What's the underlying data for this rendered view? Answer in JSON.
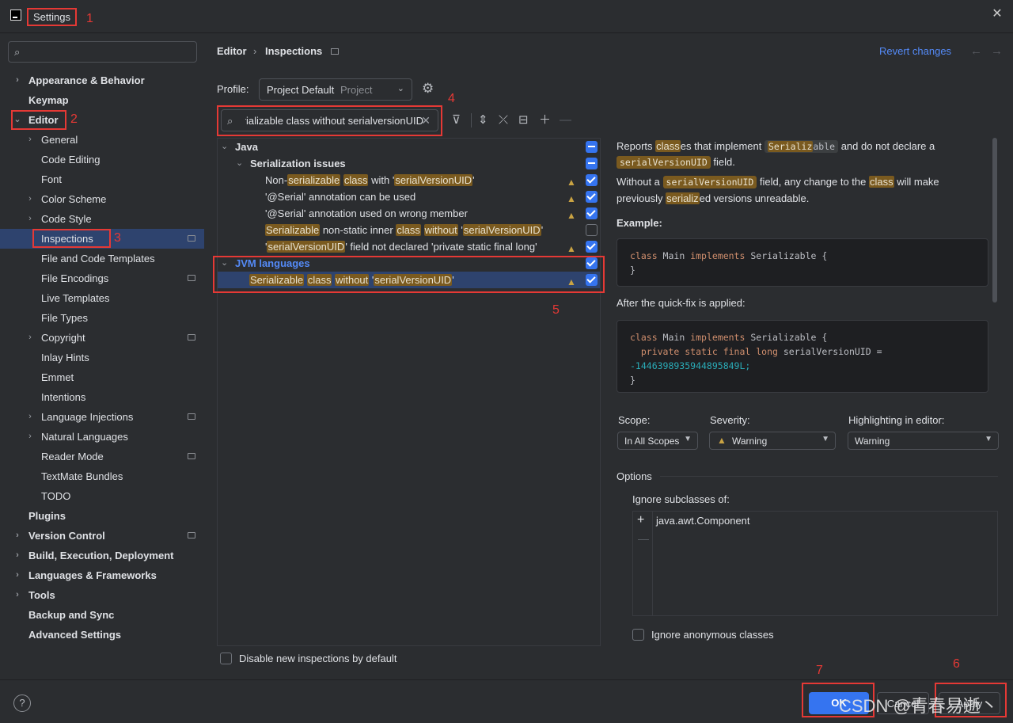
{
  "window": {
    "title": "Settings"
  },
  "search": {
    "placeholder": ""
  },
  "sidebar": {
    "items": [
      {
        "label": "Appearance & Behavior",
        "level": 0,
        "bold": true,
        "expandable": true,
        "expanded": false
      },
      {
        "label": "Keymap",
        "level": 0,
        "bold": true
      },
      {
        "label": "Editor",
        "level": 0,
        "bold": true,
        "expandable": true,
        "expanded": true
      },
      {
        "label": "General",
        "level": 1,
        "expandable": true
      },
      {
        "label": "Code Editing",
        "level": 1
      },
      {
        "label": "Font",
        "level": 1
      },
      {
        "label": "Color Scheme",
        "level": 1,
        "expandable": true
      },
      {
        "label": "Code Style",
        "level": 1,
        "expandable": true
      },
      {
        "label": "Inspections",
        "level": 1,
        "selected": true,
        "project": true
      },
      {
        "label": "File and Code Templates",
        "level": 1
      },
      {
        "label": "File Encodings",
        "level": 1,
        "project": true
      },
      {
        "label": "Live Templates",
        "level": 1
      },
      {
        "label": "File Types",
        "level": 1
      },
      {
        "label": "Copyright",
        "level": 1,
        "expandable": true,
        "project": true
      },
      {
        "label": "Inlay Hints",
        "level": 1
      },
      {
        "label": "Emmet",
        "level": 1
      },
      {
        "label": "Intentions",
        "level": 1
      },
      {
        "label": "Language Injections",
        "level": 1,
        "expandable": true,
        "project": true
      },
      {
        "label": "Natural Languages",
        "level": 1,
        "expandable": true
      },
      {
        "label": "Reader Mode",
        "level": 1,
        "project": true
      },
      {
        "label": "TextMate Bundles",
        "level": 1
      },
      {
        "label": "TODO",
        "level": 1
      },
      {
        "label": "Plugins",
        "level": 0,
        "bold": true
      },
      {
        "label": "Version Control",
        "level": 0,
        "bold": true,
        "expandable": true,
        "project": true
      },
      {
        "label": "Build, Execution, Deployment",
        "level": 0,
        "bold": true,
        "expandable": true
      },
      {
        "label": "Languages & Frameworks",
        "level": 0,
        "bold": true,
        "expandable": true
      },
      {
        "label": "Tools",
        "level": 0,
        "bold": true,
        "expandable": true
      },
      {
        "label": "Backup and Sync",
        "level": 0,
        "bold": true
      },
      {
        "label": "Advanced Settings",
        "level": 0,
        "bold": true
      }
    ]
  },
  "header": {
    "breadcrumb": [
      "Editor",
      "Inspections"
    ],
    "revert": "Revert changes",
    "back": "←",
    "forward": "→"
  },
  "profile": {
    "label": "Profile:",
    "value": "Project Default",
    "scope": "Project"
  },
  "filter": {
    "value": "Serializable class without serialversionUID"
  },
  "tree": {
    "rows": [
      {
        "type": "group",
        "level": 0,
        "parts": [
          [
            "Java",
            false
          ]
        ],
        "check": "part"
      },
      {
        "type": "group",
        "level": 1,
        "parts": [
          [
            "Serialization issues",
            false
          ]
        ],
        "check": "part"
      },
      {
        "type": "item",
        "level": 2,
        "parts": [
          [
            "Non-",
            false
          ],
          [
            "serializable",
            true
          ],
          [
            " ",
            false
          ],
          [
            "class",
            true
          ],
          [
            " with '",
            false
          ],
          [
            "serialVersionUID",
            true
          ],
          [
            "'",
            false
          ]
        ],
        "warn": true,
        "check": "on"
      },
      {
        "type": "item",
        "level": 2,
        "parts": [
          [
            "'@Serial' annotation can be used",
            false
          ]
        ],
        "warn": true,
        "check": "on"
      },
      {
        "type": "item",
        "level": 2,
        "parts": [
          [
            "'@Serial' annotation used on wrong member",
            false
          ]
        ],
        "warn": true,
        "check": "on"
      },
      {
        "type": "item",
        "level": 2,
        "parts": [
          [
            "Serializable",
            true
          ],
          [
            " non-static inner ",
            false
          ],
          [
            "class",
            true
          ],
          [
            " ",
            false
          ],
          [
            "without",
            true
          ],
          [
            " '",
            false
          ],
          [
            "serialVersionUID",
            true
          ],
          [
            "'",
            false
          ]
        ],
        "warn": false,
        "check": "off"
      },
      {
        "type": "item",
        "level": 2,
        "parts": [
          [
            "'",
            false
          ],
          [
            "serialVersionUID",
            true
          ],
          [
            "' field not declared 'private static final long'",
            false
          ]
        ],
        "warn": true,
        "check": "on"
      },
      {
        "type": "group",
        "level": 0,
        "parts": [
          [
            "JVM languages",
            false
          ]
        ],
        "check": "on",
        "blue": true
      },
      {
        "type": "item",
        "level": 1,
        "parts": [
          [
            "Serializable",
            true
          ],
          [
            " ",
            false
          ],
          [
            "class",
            true
          ],
          [
            " ",
            false
          ],
          [
            "without",
            true
          ],
          [
            " '",
            false
          ],
          [
            "serialVersionUID",
            true
          ],
          [
            "'",
            false
          ]
        ],
        "warn": true,
        "check": "on",
        "selected": true
      }
    ]
  },
  "disable_new": "Disable new inspections by default",
  "description": {
    "p1_a": "Reports ",
    "p1_class": "class",
    "p1_b": "es that implement ",
    "p1_code_hl": "Serializ",
    "p1_code": "able",
    "p1_c": " and do not declare a",
    "p1_code2": "serialVersionUID",
    "p1_d": " field.",
    "p2_a": "Without a ",
    "p2_code": "serialVersionUID",
    "p2_b": " field, any change to the ",
    "p2_class": "class",
    "p2_c": " will make",
    "p2_d": "previously ",
    "p2_hl": "serializ",
    "p2_e": "ed versions unreadable.",
    "example": "Example:",
    "code1": [
      "class Main implements Serializable {",
      "}"
    ],
    "after": "After the quick-fix is applied:",
    "code2": [
      "class Main implements Serializable {",
      "  private static final long serialVersionUID =",
      "-1446398935944895849L;",
      "}"
    ]
  },
  "settings": {
    "scope_label": "Scope:",
    "scope_value": "In All Scopes",
    "severity_label": "Severity:",
    "severity_value": "Warning",
    "highlight_label": "Highlighting in editor:",
    "highlight_value": "Warning",
    "options_label": "Options",
    "ignore_label": "Ignore subclasses of:",
    "ignore_item": "java.awt.Component",
    "anon_label": "Ignore anonymous classes"
  },
  "footer": {
    "ok": "OK",
    "cancel": "Cancel",
    "apply": "Apply",
    "help": "?"
  },
  "annotations": [
    "1",
    "2",
    "3",
    "4",
    "5",
    "6",
    "7"
  ],
  "watermark": "CSDN @青春易逝丶",
  "colors": {
    "accent": "#3574f0",
    "selection": "#2e436e",
    "highlight": "#7a5a1f",
    "annotation": "#e53935"
  }
}
